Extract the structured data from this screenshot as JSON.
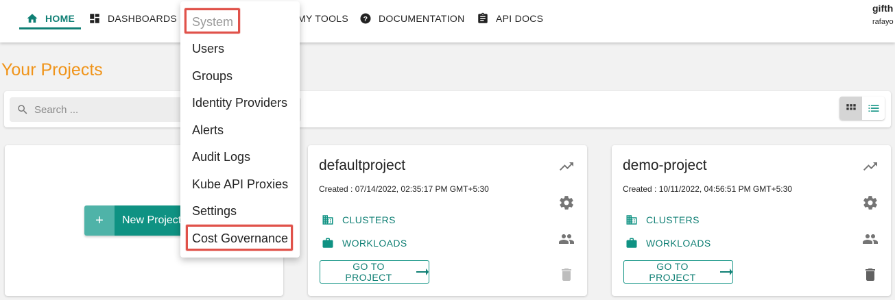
{
  "nav": {
    "home": "HOME",
    "dashboards": "DASHBOARDS",
    "my_tools": "MY TOOLS",
    "documentation": "DOCUMENTATION",
    "api_docs": "API DOCS"
  },
  "user": {
    "name": "gifth",
    "org": "rafayo"
  },
  "page": {
    "title": "Your Projects"
  },
  "search": {
    "placeholder": "Search ..."
  },
  "new_project": {
    "plus": "+",
    "label": "New Project"
  },
  "projects": [
    {
      "name": "defaultproject",
      "created": "Created : 07/14/2022, 02:35:17 PM GMT+5:30",
      "clusters": "CLUSTERS",
      "workloads": "WORKLOADS",
      "goto": "GO TO PROJECT"
    },
    {
      "name": "demo-project",
      "created": "Created : 10/11/2022, 04:56:51 PM GMT+5:30",
      "clusters": "CLUSTERS",
      "workloads": "WORKLOADS",
      "goto": "GO TO PROJECT"
    }
  ],
  "menu": {
    "items": [
      "System",
      "Users",
      "Groups",
      "Identity Providers",
      "Alerts",
      "Audit Logs",
      "Kube API Proxies",
      "Settings",
      "Cost Governance"
    ]
  },
  "colors": {
    "accent": "#0f7f74",
    "title": "#f0941a",
    "highlight": "#e0524a"
  },
  "icons": [
    "home-icon",
    "dashboard-icon",
    "help-icon",
    "clipboard-icon",
    "search-icon",
    "grid-view-icon",
    "list-view-icon",
    "trend-icon",
    "gear-icon",
    "people-icon",
    "trash-icon",
    "cluster-icon",
    "briefcase-icon",
    "arrow-right-icon"
  ]
}
